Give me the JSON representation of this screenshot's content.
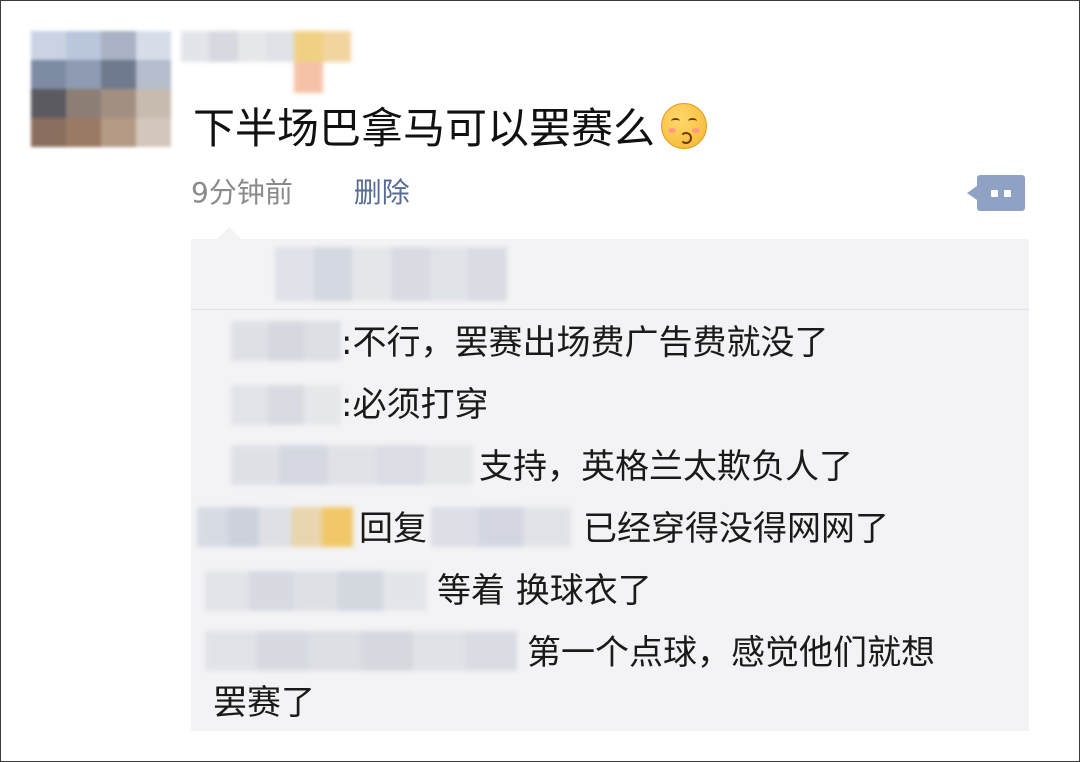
{
  "post": {
    "text": "下半场巴拿马可以罢赛么",
    "emoji": "face-with-hand-over-mouth-emoji",
    "time": "9分钟前",
    "delete_label": "删除"
  },
  "comments": [
    {
      "prefix": ":",
      "text": "不行，罢赛出场费广告费就没了"
    },
    {
      "prefix": ":",
      "text": "必须打穿"
    },
    {
      "text": "支持，英格兰太欺负人了"
    },
    {
      "reply_label": "回复",
      "text": "已经穿得没得网网了"
    },
    {
      "text": "等着 换球衣了"
    },
    {
      "text": "第一个点球，感觉他们就想",
      "text_cont": "罢赛了"
    }
  ],
  "colors": {
    "link": "#576b95",
    "time": "#8a8a8a",
    "comment_bg": "#f3f3f5",
    "more_button": "#8fa2c4"
  }
}
